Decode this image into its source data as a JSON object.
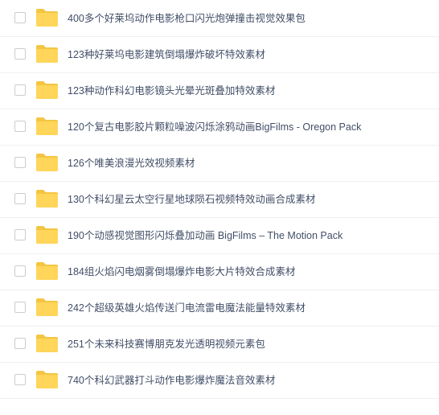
{
  "file_list": {
    "colors": {
      "folder_back": "#f4c542",
      "folder_front": "#ffd55a",
      "text": "#424e67",
      "separator": "#eef0f3"
    },
    "icon": "folder-icon",
    "items": [
      {
        "name": "400多个好莱坞动作电影枪口闪光炮弹撞击视觉效果包"
      },
      {
        "name": "123种好莱坞电影建筑倒塌爆炸破坏特效素材"
      },
      {
        "name": "123种动作科幻电影镜头光晕光斑叠加特效素材"
      },
      {
        "name": "120个复古电影胶片颗粒噪波闪烁涂鸦动画BigFilms - Oregon Pack"
      },
      {
        "name": "126个唯美浪漫光效视频素材"
      },
      {
        "name": "130个科幻星云太空行星地球陨石视频特效动画合成素材"
      },
      {
        "name": "190个动感视觉图形闪烁叠加动画 BigFilms – The Motion Pack"
      },
      {
        "name": "184组火焰闪电烟雾倒塌爆炸电影大片特效合成素材"
      },
      {
        "name": "242个超级英雄火焰传送门电流雷电魔法能量特效素材"
      },
      {
        "name": "251个未来科技赛博朋克发光透明视频元素包"
      },
      {
        "name": "740个科幻武器打斗动作电影爆炸魔法音效素材"
      }
    ]
  }
}
